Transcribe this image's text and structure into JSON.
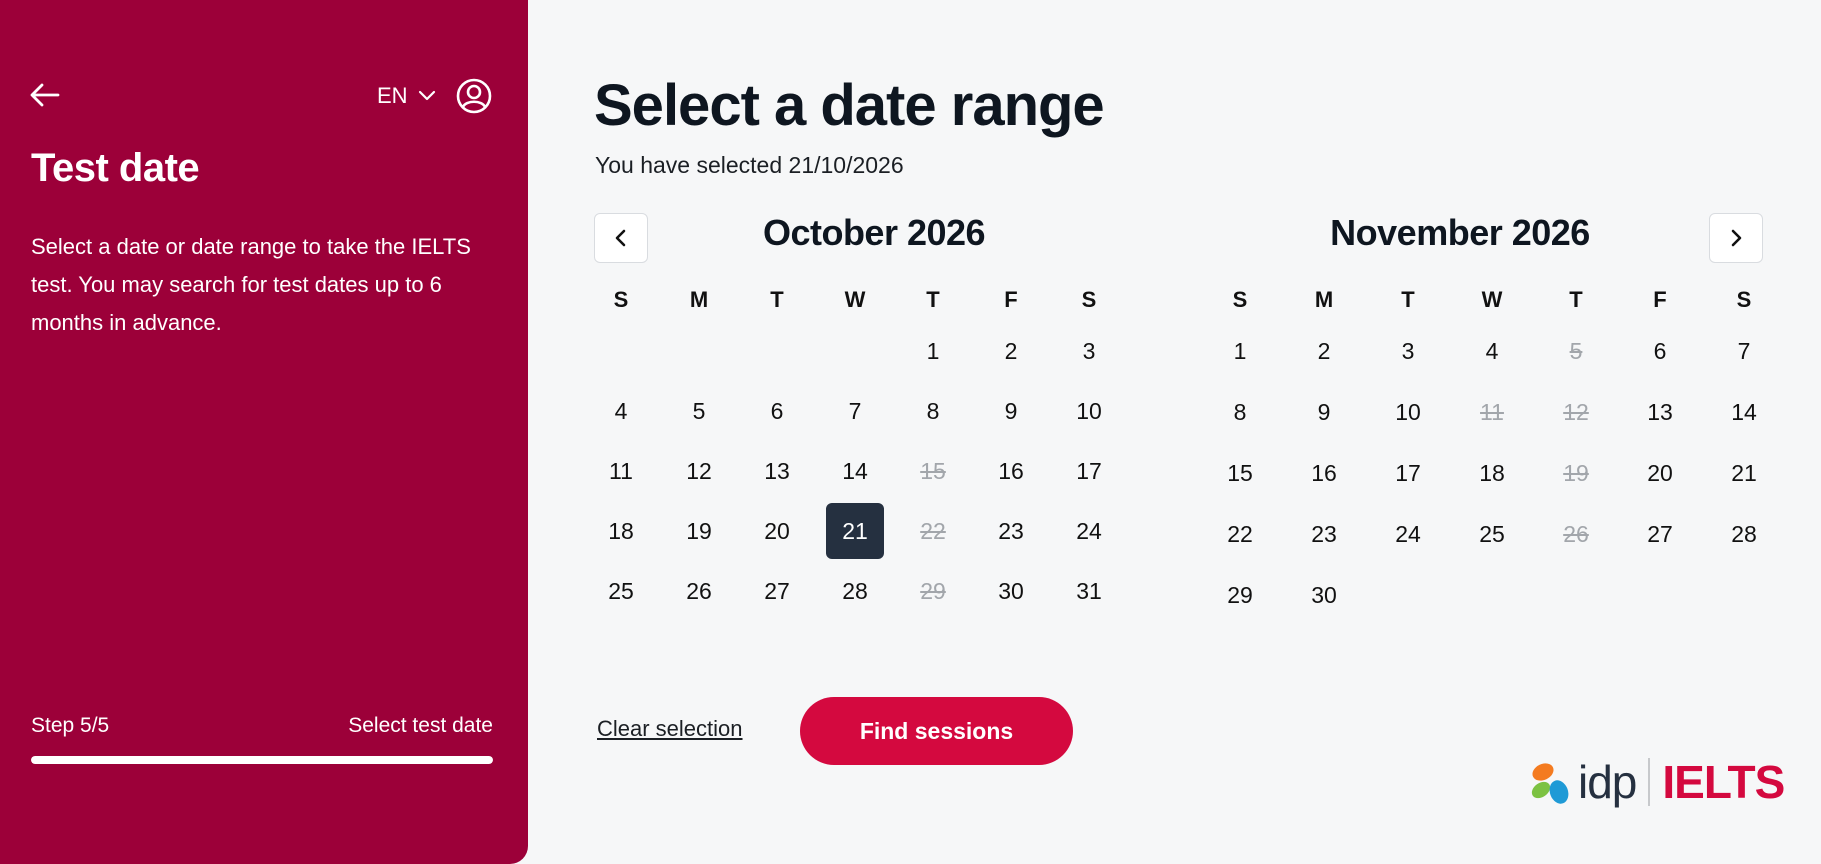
{
  "sidebar": {
    "language": "EN",
    "title": "Test date",
    "description": "Select a date or date range to take the IELTS test. You may search for test dates up to 6 months in advance.",
    "step_label": "Step 5/5",
    "step_name": "Select test date",
    "progress": 1.0,
    "accent_color": "#9c0039"
  },
  "main": {
    "title": "Select a date range",
    "subtitle": "You have selected 21/10/2026",
    "clear_label": "Clear selection",
    "find_label": "Find sessions",
    "button_color": "#d4093f"
  },
  "calendars": [
    {
      "month": "October 2026",
      "weekdays": [
        "S",
        "M",
        "T",
        "W",
        "T",
        "F",
        "S"
      ],
      "weeks": [
        [
          "",
          "",
          "",
          "",
          "1",
          "2",
          "3"
        ],
        [
          "4",
          "5",
          "6",
          "7",
          "8",
          "9",
          "10"
        ],
        [
          "11",
          "12",
          "13",
          "14",
          "15",
          "16",
          "17"
        ],
        [
          "18",
          "19",
          "20",
          "21",
          "22",
          "23",
          "24"
        ],
        [
          "25",
          "26",
          "27",
          "28",
          "29",
          "30",
          "31"
        ]
      ],
      "disabled": [
        "15",
        "22",
        "29"
      ],
      "selected": "21"
    },
    {
      "month": "November 2026",
      "weekdays": [
        "S",
        "M",
        "T",
        "W",
        "T",
        "F",
        "S"
      ],
      "weeks": [
        [
          "1",
          "2",
          "3",
          "4",
          "5",
          "6",
          "7"
        ],
        [
          "8",
          "9",
          "10",
          "11",
          "12",
          "13",
          "14"
        ],
        [
          "15",
          "16",
          "17",
          "18",
          "19",
          "20",
          "21"
        ],
        [
          "22",
          "23",
          "24",
          "25",
          "26",
          "27",
          "28"
        ],
        [
          "29",
          "30",
          "",
          "",
          "",
          "",
          ""
        ]
      ],
      "disabled": [
        "5",
        "11",
        "12",
        "19",
        "26"
      ],
      "selected": ""
    }
  ],
  "logo": {
    "brand": "idp",
    "product": "IELTS"
  },
  "icons": {
    "back": "arrow-left-icon",
    "language": "chevron-down-icon",
    "account": "user-circle-icon",
    "prev": "chevron-left-icon",
    "next": "chevron-right-icon"
  }
}
